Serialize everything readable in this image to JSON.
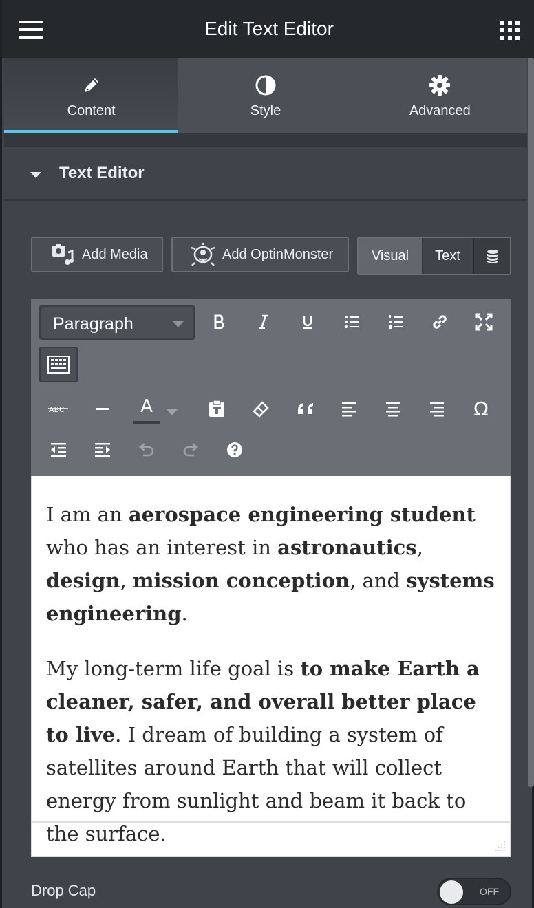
{
  "header": {
    "title": "Edit Text Editor",
    "menu_icon": "hamburger-icon",
    "apps_icon": "grid-icon"
  },
  "tabs": [
    {
      "label": "Content",
      "icon": "pencil-icon",
      "active": true
    },
    {
      "label": "Style",
      "icon": "contrast-icon",
      "active": false
    },
    {
      "label": "Advanced",
      "icon": "gear-icon",
      "active": false
    }
  ],
  "section": {
    "title": "Text Editor"
  },
  "media_buttons": {
    "add_media": "Add Media",
    "add_optinmonster": "Add OptinMonster"
  },
  "editor_mode": {
    "visual": "Visual",
    "text": "Text",
    "active": "Visual"
  },
  "toolbar": {
    "format_select": "Paragraph",
    "text_color_glyph": "A",
    "omega_glyph": "Ω"
  },
  "content": {
    "p1": {
      "t1": "I am an ",
      "b1": "aerospace engineering student",
      "t2": " who has an interest in ",
      "b2": "astronautics",
      "t3": ", ",
      "b3": "design",
      "t4": ", ",
      "b4": "mission conception",
      "t5": ", and ",
      "b5": "systems engineering",
      "t6": "."
    },
    "p2": {
      "t1": "My long-term life goal is ",
      "b1": "to make Earth a cleaner, safer, and overall better place to live",
      "t2": ". I dream of building a system of satellites around Earth that will collect energy from sunlight and beam it back to the surface."
    }
  },
  "drop_cap": {
    "label": "Drop Cap",
    "state": "OFF"
  },
  "colors": {
    "accent": "#58c5eb",
    "header_bg": "#26292c",
    "panel_bg": "#404349"
  }
}
